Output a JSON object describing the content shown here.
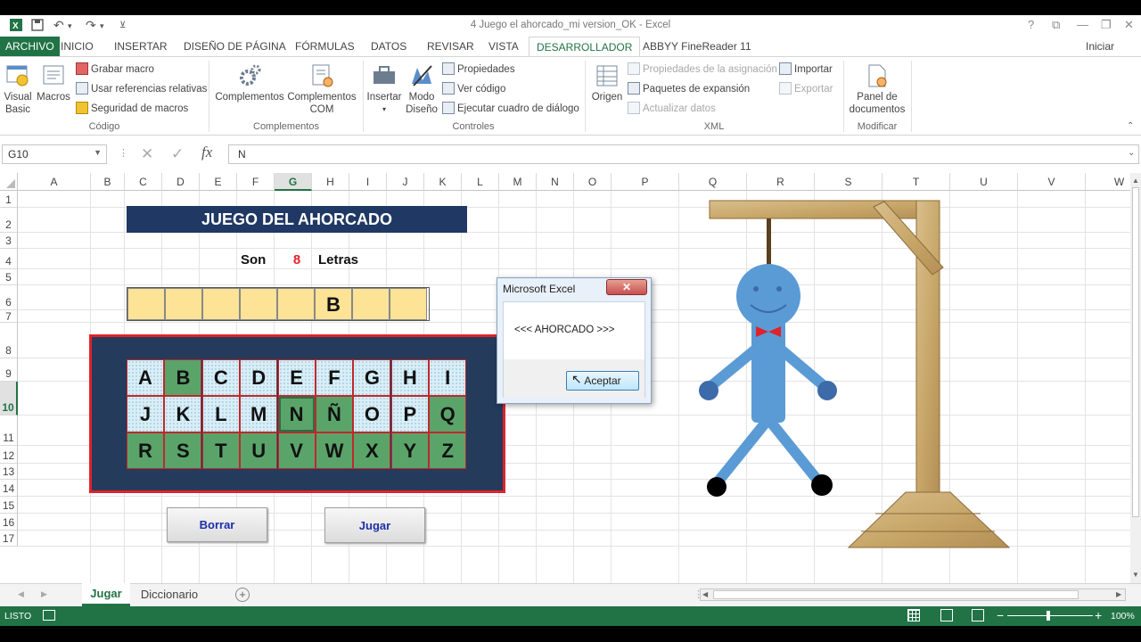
{
  "window": {
    "title": "4 Juego el ahorcado_mi version_OK - Excel",
    "help": "?",
    "signin": "Iniciar sesión"
  },
  "tabs": [
    "ARCHIVO",
    "INICIO",
    "INSERTAR",
    "DISEÑO DE PÁGINA",
    "FÓRMULAS",
    "DATOS",
    "REVISAR",
    "VISTA",
    "DESARROLLADOR",
    "ABBYY FineReader 11"
  ],
  "ribbon": {
    "visual_basic": [
      "Visual",
      "Basic"
    ],
    "macros": "Macros",
    "grabar_macro": "Grabar macro",
    "usar_ref": "Usar referencias relativas",
    "seguridad": "Seguridad de macros",
    "grp_codigo": "Código",
    "complementos": "Complementos",
    "complementos_com": [
      "Complementos",
      "COM"
    ],
    "grp_complementos": "Complementos",
    "insertar": "Insertar",
    "modo_diseno": [
      "Modo",
      "Diseño"
    ],
    "propiedades": "Propiedades",
    "ver_codigo": "Ver código",
    "ejecutar": "Ejecutar cuadro de diálogo",
    "grp_controles": "Controles",
    "origen": "Origen",
    "prop_asignacion": "Propiedades de la asignación",
    "paquetes": "Paquetes de expansión",
    "actualizar": "Actualizar datos",
    "importar": "Importar",
    "exportar": "Exportar",
    "grp_xml": "XML",
    "panel_doc": [
      "Panel de",
      "documentos"
    ],
    "grp_modificar": "Modificar"
  },
  "formula": {
    "namebox": "G10",
    "fx": "fx",
    "content": "N"
  },
  "columns": [
    "A",
    "B",
    "C",
    "D",
    "E",
    "F",
    "G",
    "H",
    "I",
    "J",
    "K",
    "L",
    "M",
    "N",
    "O",
    "P",
    "Q",
    "R",
    "S",
    "T",
    "U",
    "V",
    "W"
  ],
  "selected_column": "G",
  "rows": [
    "1",
    "2",
    "3",
    "4",
    "5",
    "6",
    "7",
    "8",
    "9",
    "10",
    "11",
    "12",
    "13",
    "14",
    "15",
    "16",
    "17"
  ],
  "selected_row": "10",
  "game": {
    "title": "JUEGO DEL AHORCADO",
    "son": "Son",
    "count": "8",
    "letras": "Letras",
    "slots": [
      "",
      "",
      "",
      "",
      "",
      "B",
      "",
      ""
    ],
    "keyboard": [
      [
        {
          "l": "A",
          "u": false
        },
        {
          "l": "B",
          "u": true
        },
        {
          "l": "C",
          "u": false
        },
        {
          "l": "D",
          "u": false
        },
        {
          "l": "E",
          "u": false
        },
        {
          "l": "F",
          "u": false
        },
        {
          "l": "G",
          "u": false
        },
        {
          "l": "H",
          "u": false
        },
        {
          "l": "I",
          "u": false
        }
      ],
      [
        {
          "l": "J",
          "u": false
        },
        {
          "l": "K",
          "u": false
        },
        {
          "l": "L",
          "u": false
        },
        {
          "l": "M",
          "u": false
        },
        {
          "l": "N",
          "u": true
        },
        {
          "l": "Ñ",
          "u": true
        },
        {
          "l": "O",
          "u": false
        },
        {
          "l": "P",
          "u": false
        },
        {
          "l": "Q",
          "u": true
        }
      ],
      [
        {
          "l": "R",
          "u": true
        },
        {
          "l": "S",
          "u": true
        },
        {
          "l": "T",
          "u": true
        },
        {
          "l": "U",
          "u": true
        },
        {
          "l": "V",
          "u": true
        },
        {
          "l": "W",
          "u": true
        },
        {
          "l": "X",
          "u": true
        },
        {
          "l": "Y",
          "u": true
        },
        {
          "l": "Z",
          "u": true
        }
      ]
    ],
    "borrar": "Borrar",
    "jugar": "Jugar"
  },
  "dialog": {
    "title": "Microsoft Excel",
    "message": "<<< AHORCADO >>>",
    "ok": "Aceptar"
  },
  "sheets": [
    "Jugar",
    "Diccionario"
  ],
  "active_sheet": "Jugar",
  "status": {
    "mode": "LISTO",
    "zoom": "100%"
  },
  "colors": {
    "excel_green": "#217346",
    "title_bg": "#1f3864",
    "panel_bg": "#243b5c",
    "panel_border": "#e0222b",
    "key_used": "#5aa46a",
    "slot_fill": "#fde396",
    "figure_blue": "#5b9bd5"
  }
}
